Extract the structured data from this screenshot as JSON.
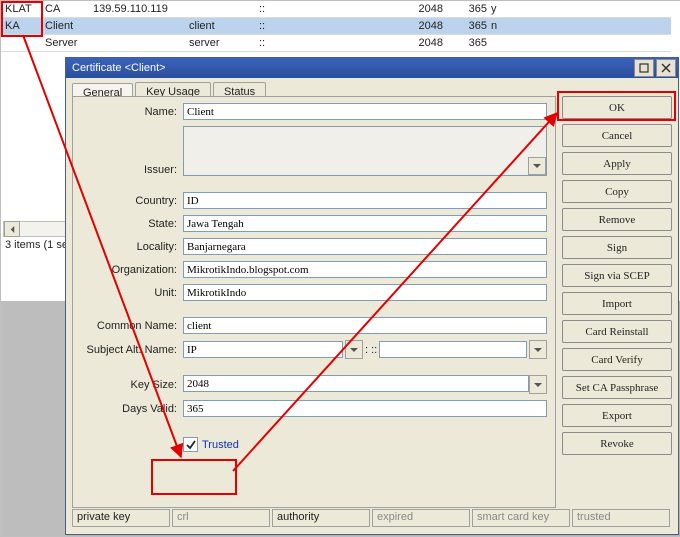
{
  "table": {
    "rows": [
      {
        "flags": "KLAT",
        "b": "CA",
        "c": "139.59.110.119",
        "d": "",
        "e": "::",
        "f": "",
        "g": "2048",
        "h": "365",
        "i": "y"
      },
      {
        "flags": "KA",
        "b": "Client",
        "c": "",
        "d": "client",
        "e": "::",
        "f": "",
        "g": "2048",
        "h": "365",
        "i": "n"
      },
      {
        "flags": "",
        "b": "Server",
        "c": "",
        "d": "server",
        "e": "::",
        "f": "",
        "g": "2048",
        "h": "365",
        "i": ""
      }
    ],
    "status": "3 items (1 se"
  },
  "dialog": {
    "title": "Certificate <Client>",
    "tabs": [
      "General",
      "Key Usage",
      "Status"
    ],
    "fields": {
      "name_label": "Name:",
      "name": "Client",
      "issuer_label": "Issuer:",
      "country_label": "Country:",
      "country": "ID",
      "state_label": "State:",
      "state": "Jawa Tengah",
      "locality_label": "Locality:",
      "locality": "Banjarnegara",
      "organization_label": "Organization:",
      "organization": "MikrotikIndo.blogspot.com",
      "unit_label": "Unit:",
      "unit": "MikrotikIndo",
      "common_name_label": "Common Name:",
      "common_name": "client",
      "san_label": "Subject Alt. Name:",
      "san_type": "IP",
      "san_value": "::",
      "key_size_label": "Key Size:",
      "key_size": "2048",
      "days_valid_label": "Days Valid:",
      "days_valid": "365",
      "trusted_label": "Trusted"
    },
    "buttons": [
      "OK",
      "Cancel",
      "Apply",
      "Copy",
      "Remove",
      "Sign",
      "Sign via SCEP",
      "Import",
      "Card Reinstall",
      "Card Verify",
      "Set CA Passphrase",
      "Export",
      "Revoke"
    ],
    "status": [
      "private key",
      "crl",
      "authority",
      "expired",
      "smart card key",
      "trusted"
    ]
  },
  "icons": {
    "chevron_down": "▾",
    "chevron_left": "◂",
    "minimize": "▁",
    "close": "✕",
    "sep": ": ::"
  }
}
